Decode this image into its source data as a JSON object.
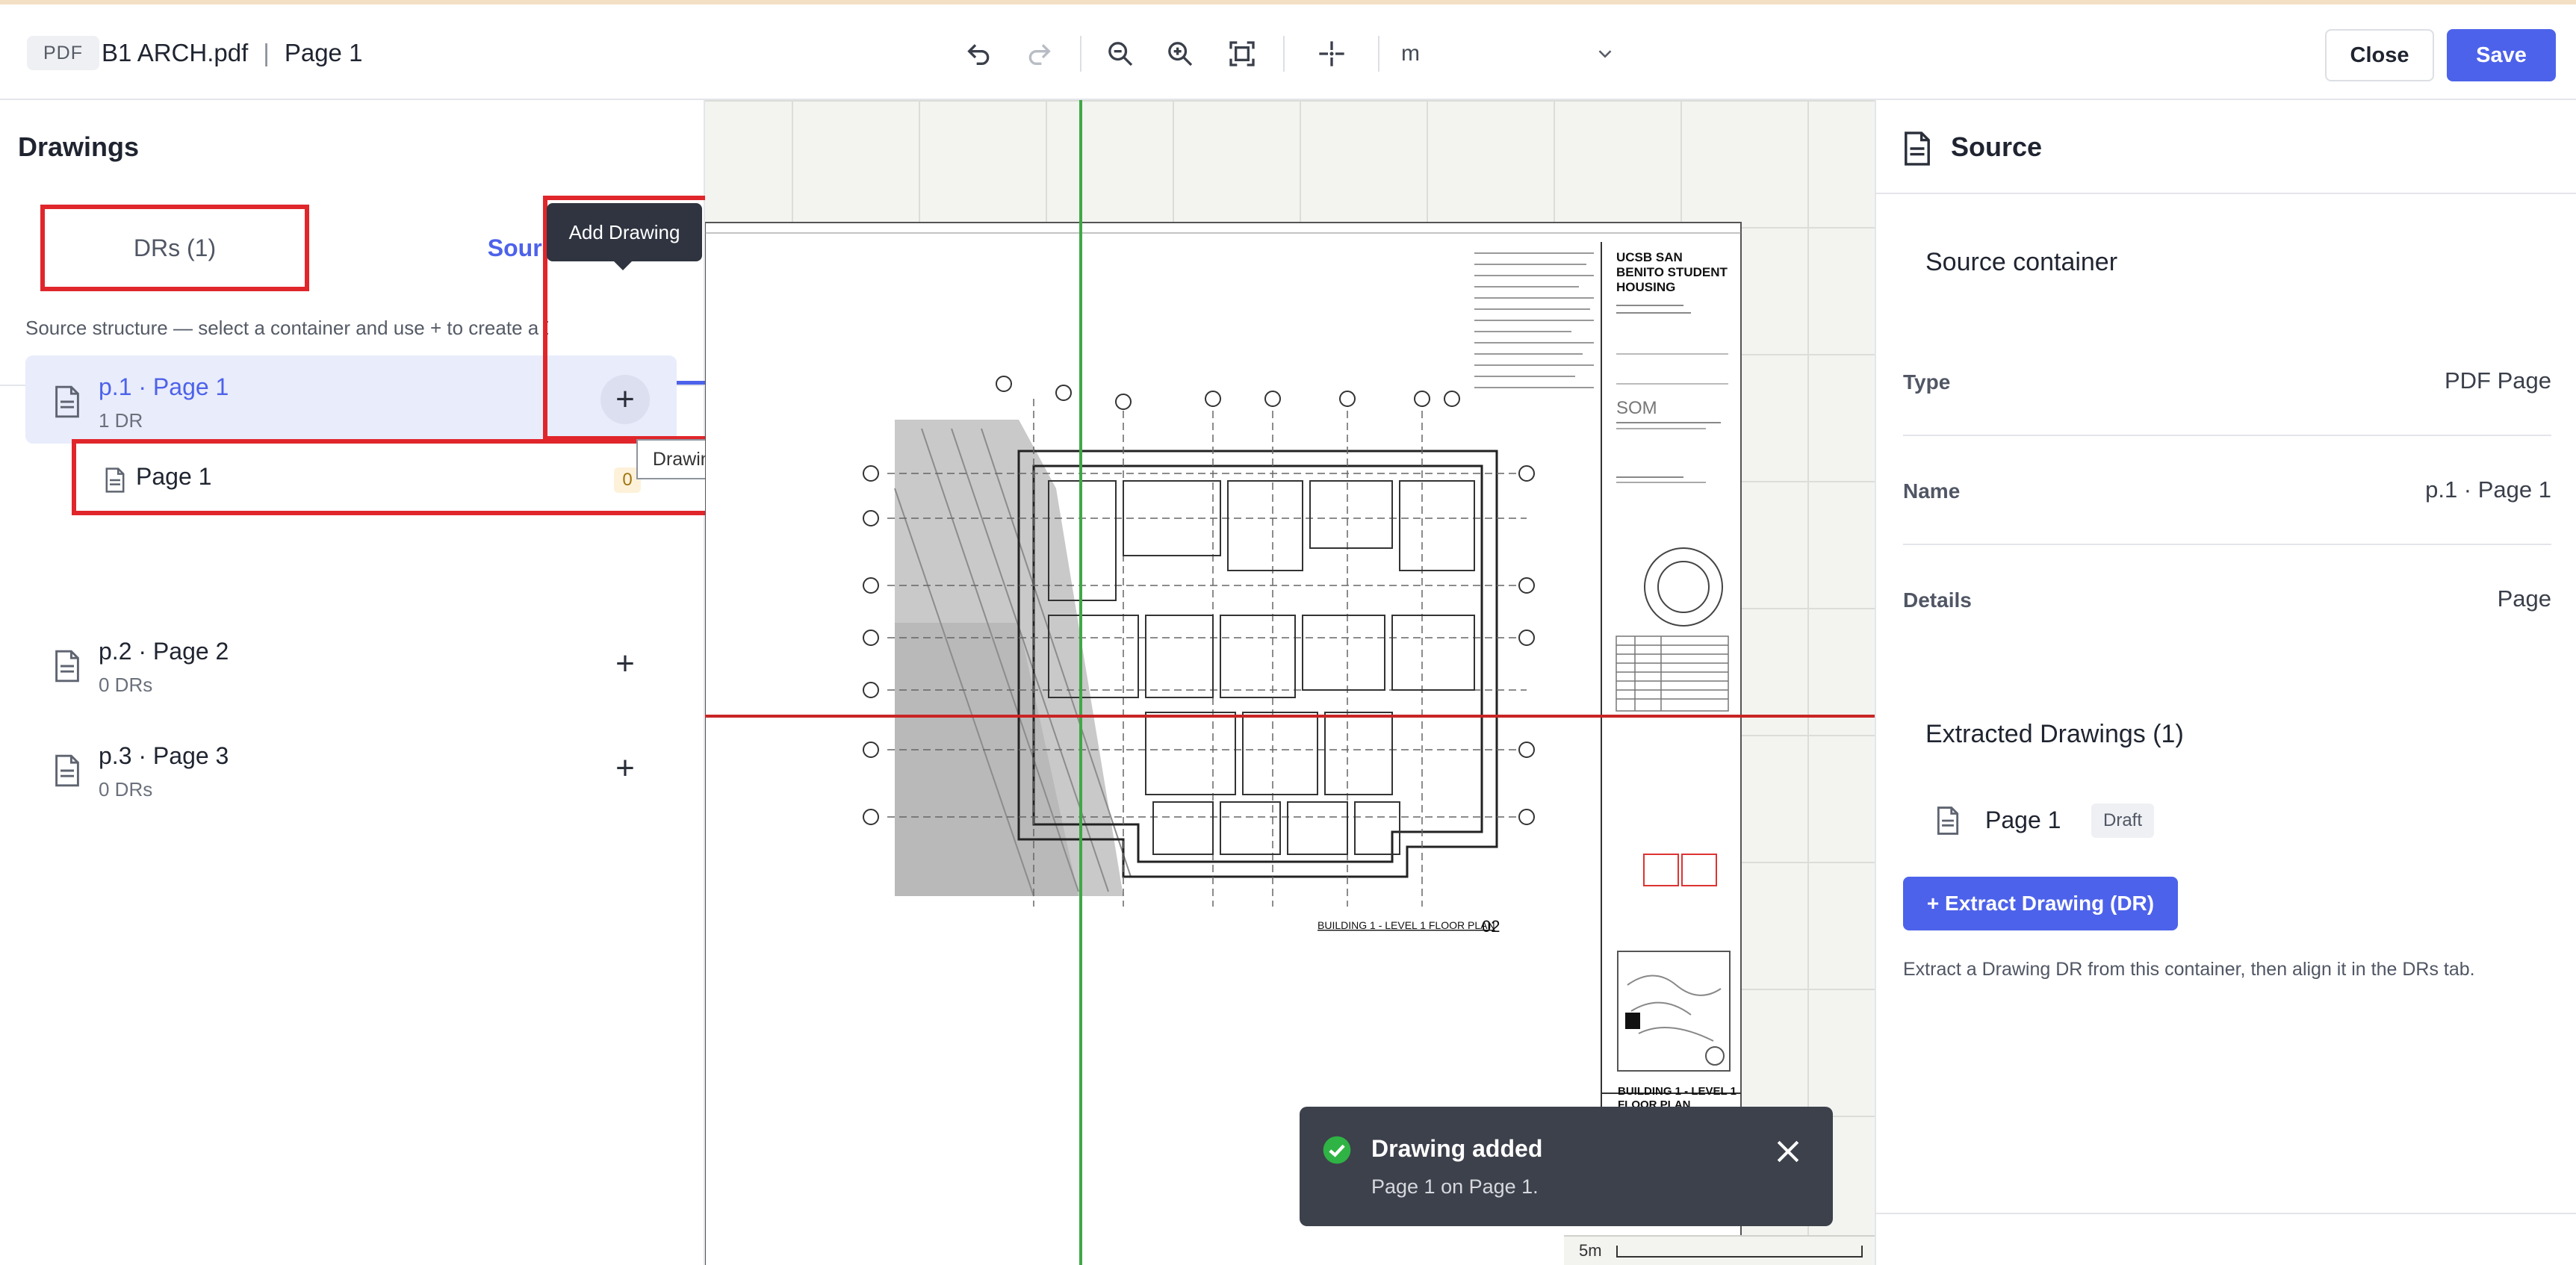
{
  "header": {
    "file_badge": "PDF",
    "file_name": "B1 ARCH.pdf",
    "separator": "|",
    "page_label": "Page 1",
    "unit_value": "m",
    "close_label": "Close",
    "save_label": "Save"
  },
  "left": {
    "heading": "Drawings",
    "tab_drs": "DRs (1)",
    "tab_source": "Source",
    "hint": "Source structure — select a container and use + to create a D",
    "tooltip_add": "Add Drawing",
    "tooltip_drawings": "Drawings",
    "pages": [
      {
        "title": "p.1 · Page 1",
        "sub": "1 DR",
        "add": "+"
      },
      {
        "title": "p.2 · Page 2",
        "sub": "0 DRs",
        "add": "+"
      },
      {
        "title": "p.3 · Page 3",
        "sub": "0 DRs",
        "add": "+"
      }
    ],
    "child": {
      "title": "Page 1",
      "count": "0"
    }
  },
  "canvas": {
    "scale_label": "5m",
    "sheet_title_1": "UCSB SAN",
    "sheet_title_2": "BENITO STUDENT",
    "sheet_title_3": "HOUSING",
    "sheet_firm": "SOM",
    "plan_caption": "BUILDING 1 - LEVEL 1 FLOOR PLAN",
    "plan_number": "02",
    "sheet_footer_1": "BUILDING 1 - LEVEL 1",
    "sheet_footer_2": "FLOOR PLAN"
  },
  "toast": {
    "title": "Drawing added",
    "body": "Page 1 on Page 1."
  },
  "right": {
    "title": "Source",
    "section_container": "Source container",
    "props": [
      {
        "key": "Type",
        "value": "PDF Page"
      },
      {
        "key": "Name",
        "value": "p.1 · Page 1"
      },
      {
        "key": "Details",
        "value": "Page"
      }
    ],
    "section_extracted": "Extracted Drawings (1)",
    "extracted": {
      "title": "Page 1",
      "status": "Draft"
    },
    "extract_button": "+ Extract Drawing (DR)",
    "note": "Extract a Drawing DR from this container, then align it in the DRs tab."
  },
  "colors": {
    "accent": "#4d62ea",
    "highlight_red": "#e0262b",
    "guide_green": "#3fa845",
    "guide_red": "#c92525",
    "toast_bg": "#3d414b",
    "success": "#2fb344"
  }
}
